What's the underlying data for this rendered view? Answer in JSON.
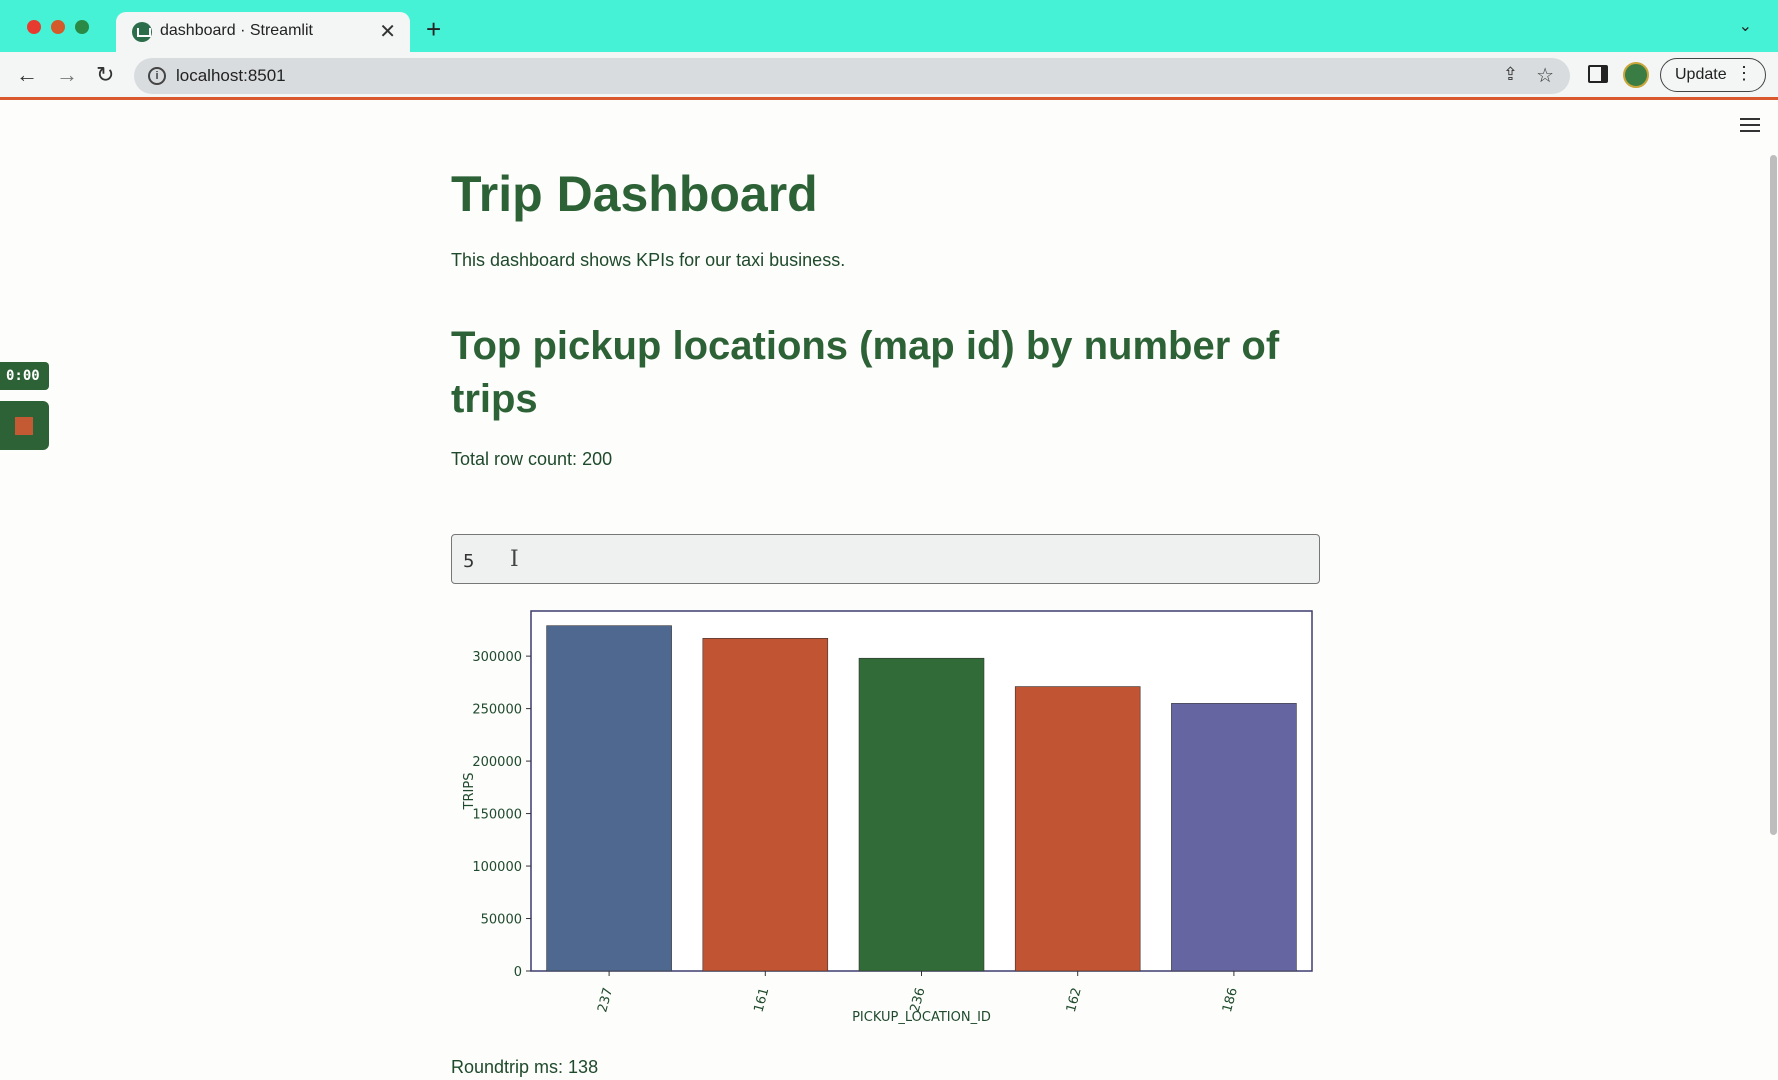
{
  "browser": {
    "tab_title": "dashboard · Streamlit",
    "tab_close": "✕",
    "new_tab": "+",
    "tab_menu": "⌄",
    "url": "localhost:8501",
    "update_label": "Update",
    "update_menu": "⋮",
    "back": "←",
    "forward": "→",
    "reload": "↻",
    "info": "i",
    "share": "⇪",
    "star": "☆"
  },
  "recorder": {
    "timer": "0:00"
  },
  "page": {
    "title": "Trip Dashboard",
    "subtitle": "This dashboard shows KPIs for our taxi business.",
    "section_title": "Top pickup locations (map id) by number of trips",
    "row_count": "Total row count: 200",
    "input_value": "5",
    "cursor": "I",
    "roundtrip": "Roundtrip ms: 138"
  },
  "chart_data": {
    "type": "bar",
    "categories": [
      "237",
      "161",
      "236",
      "162",
      "186"
    ],
    "values": [
      329000,
      317000,
      298000,
      271000,
      255000
    ],
    "colors": [
      "#4f688f",
      "#c15433",
      "#316b37",
      "#c15433",
      "#6565a2"
    ],
    "xlabel": "PICKUP_LOCATION_ID",
    "ylabel": "TRIPS",
    "ylim": [
      0,
      343000
    ],
    "yticks": [
      0,
      50000,
      100000,
      150000,
      200000,
      250000,
      300000
    ]
  }
}
